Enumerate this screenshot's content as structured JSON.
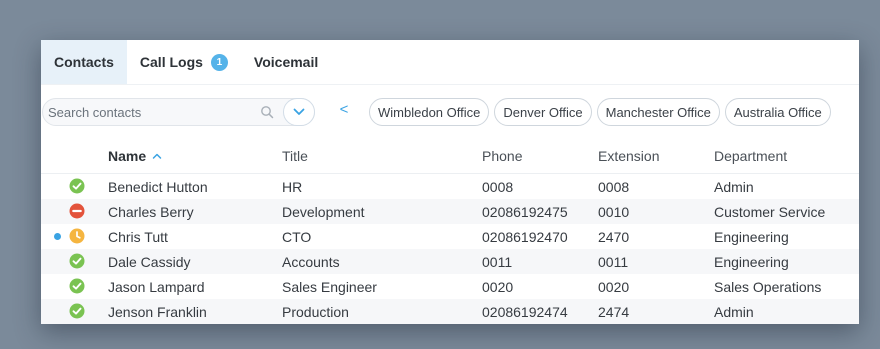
{
  "tabs": [
    {
      "label": "Contacts",
      "active": true
    },
    {
      "label": "Call Logs",
      "badge": "1"
    },
    {
      "label": "Voicemail"
    }
  ],
  "filter": {
    "search_placeholder": "Search contacts",
    "prev_label": "<",
    "offices": [
      "Wimbledon Office",
      "Denver Office",
      "Manchester Office",
      "Australia Office"
    ]
  },
  "table": {
    "columns": {
      "name": "Name",
      "title": "Title",
      "phone": "Phone",
      "extension": "Extension",
      "department": "Department"
    },
    "rows": [
      {
        "status": "available",
        "name": "Benedict Hutton",
        "title": "HR",
        "phone": "0008",
        "extension": "0008",
        "department": "Admin"
      },
      {
        "status": "busy",
        "name": "Charles Berry",
        "title": "Development",
        "phone": "02086192475",
        "extension": "0010",
        "department": "Customer Service"
      },
      {
        "status": "away",
        "unread": true,
        "name": "Chris Tutt",
        "title": "CTO",
        "phone": "02086192470",
        "extension": "2470",
        "department": "Engineering"
      },
      {
        "status": "available",
        "name": "Dale Cassidy",
        "title": "Accounts",
        "phone": "0011",
        "extension": "0011",
        "department": "Engineering"
      },
      {
        "status": "available",
        "name": "Jason Lampard",
        "title": "Sales Engineer",
        "phone": "0020",
        "extension": "0020",
        "department": "Sales Operations"
      },
      {
        "status": "available",
        "name": "Jenson Franklin",
        "title": "Production",
        "phone": "02086192474",
        "extension": "2474",
        "department": "Admin"
      }
    ]
  },
  "colors": {
    "accent": "#3aa3e3",
    "available": "#7ac352",
    "busy": "#e3533b",
    "away": "#f5b540",
    "active_tab_bg": "#e7f1f9"
  }
}
